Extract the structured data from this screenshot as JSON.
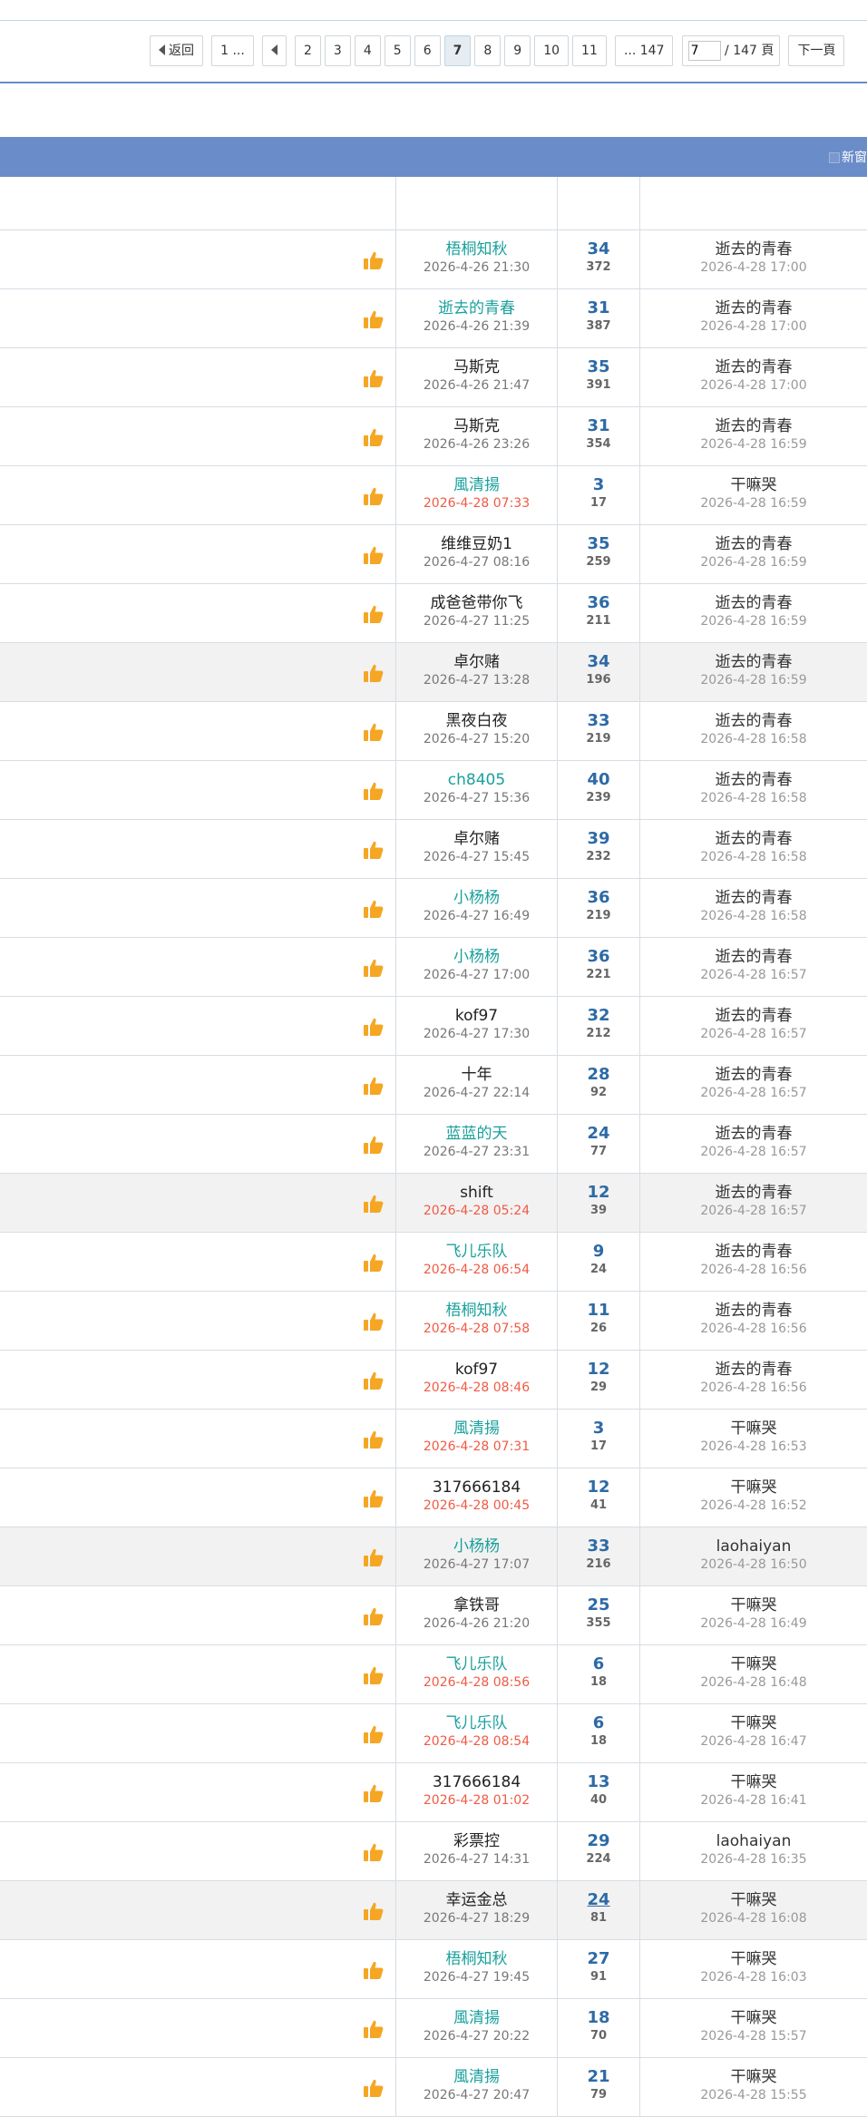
{
  "pager": {
    "back_label": "返回",
    "first_label": "1 ...",
    "pages": [
      "2",
      "3",
      "4",
      "5",
      "6",
      "7",
      "8",
      "9",
      "10",
      "11"
    ],
    "current_page": "7",
    "last_label": "... 147",
    "jump_value": "7",
    "total_label": "/ 147 頁",
    "next_label": "下一頁"
  },
  "header": {
    "newwin_label": "新窗"
  },
  "rows": [
    {
      "author": "梧桐知秋",
      "author_style": "teal",
      "date": "2026-4-26 21:30",
      "date_style": "normal",
      "replies": "34",
      "views": "372",
      "last_user": "逝去的青春",
      "last_date": "2026-4-28 17:00",
      "alt": false,
      "underline": false
    },
    {
      "author": "逝去的青春",
      "author_style": "teal",
      "date": "2026-4-26 21:39",
      "date_style": "normal",
      "replies": "31",
      "views": "387",
      "last_user": "逝去的青春",
      "last_date": "2026-4-28 17:00",
      "alt": false,
      "underline": false
    },
    {
      "author": "马斯克",
      "author_style": "dark",
      "date": "2026-4-26 21:47",
      "date_style": "normal",
      "replies": "35",
      "views": "391",
      "last_user": "逝去的青春",
      "last_date": "2026-4-28 17:00",
      "alt": false,
      "underline": false
    },
    {
      "author": "马斯克",
      "author_style": "dark",
      "date": "2026-4-26 23:26",
      "date_style": "normal",
      "replies": "31",
      "views": "354",
      "last_user": "逝去的青春",
      "last_date": "2026-4-28 16:59",
      "alt": false,
      "underline": false
    },
    {
      "author": "風清揚",
      "author_style": "teal",
      "date": "2026-4-28 07:33",
      "date_style": "new",
      "replies": "3",
      "views": "17",
      "last_user": "干嘛哭",
      "last_date": "2026-4-28 16:59",
      "alt": false,
      "underline": false
    },
    {
      "author": "维维豆奶1",
      "author_style": "dark",
      "date": "2026-4-27 08:16",
      "date_style": "normal",
      "replies": "35",
      "views": "259",
      "last_user": "逝去的青春",
      "last_date": "2026-4-28 16:59",
      "alt": false,
      "underline": false
    },
    {
      "author": "成爸爸带你飞",
      "author_style": "dark",
      "date": "2026-4-27 11:25",
      "date_style": "normal",
      "replies": "36",
      "views": "211",
      "last_user": "逝去的青春",
      "last_date": "2026-4-28 16:59",
      "alt": false,
      "underline": false
    },
    {
      "author": "卓尔赌",
      "author_style": "dark",
      "date": "2026-4-27 13:28",
      "date_style": "normal",
      "replies": "34",
      "views": "196",
      "last_user": "逝去的青春",
      "last_date": "2026-4-28 16:59",
      "alt": true,
      "underline": false
    },
    {
      "author": "黑夜白夜",
      "author_style": "dark",
      "date": "2026-4-27 15:20",
      "date_style": "normal",
      "replies": "33",
      "views": "219",
      "last_user": "逝去的青春",
      "last_date": "2026-4-28 16:58",
      "alt": false,
      "underline": false
    },
    {
      "author": "ch8405",
      "author_style": "teal",
      "date": "2026-4-27 15:36",
      "date_style": "normal",
      "replies": "40",
      "views": "239",
      "last_user": "逝去的青春",
      "last_date": "2026-4-28 16:58",
      "alt": false,
      "underline": false
    },
    {
      "author": "卓尔赌",
      "author_style": "dark",
      "date": "2026-4-27 15:45",
      "date_style": "normal",
      "replies": "39",
      "views": "232",
      "last_user": "逝去的青春",
      "last_date": "2026-4-28 16:58",
      "alt": false,
      "underline": false
    },
    {
      "author": "小杨杨",
      "author_style": "teal",
      "date": "2026-4-27 16:49",
      "date_style": "normal",
      "replies": "36",
      "views": "219",
      "last_user": "逝去的青春",
      "last_date": "2026-4-28 16:58",
      "alt": false,
      "underline": false
    },
    {
      "author": "小杨杨",
      "author_style": "teal",
      "date": "2026-4-27 17:00",
      "date_style": "normal",
      "replies": "36",
      "views": "221",
      "last_user": "逝去的青春",
      "last_date": "2026-4-28 16:57",
      "alt": false,
      "underline": false
    },
    {
      "author": "kof97",
      "author_style": "dark",
      "date": "2026-4-27 17:30",
      "date_style": "normal",
      "replies": "32",
      "views": "212",
      "last_user": "逝去的青春",
      "last_date": "2026-4-28 16:57",
      "alt": false,
      "underline": false
    },
    {
      "author": "十年",
      "author_style": "dark",
      "date": "2026-4-27 22:14",
      "date_style": "normal",
      "replies": "28",
      "views": "92",
      "last_user": "逝去的青春",
      "last_date": "2026-4-28 16:57",
      "alt": false,
      "underline": false
    },
    {
      "author": "蓝蓝的天",
      "author_style": "teal",
      "date": "2026-4-27 23:31",
      "date_style": "normal",
      "replies": "24",
      "views": "77",
      "last_user": "逝去的青春",
      "last_date": "2026-4-28 16:57",
      "alt": false,
      "underline": false
    },
    {
      "author": "shift",
      "author_style": "dark",
      "date": "2026-4-28 05:24",
      "date_style": "new",
      "replies": "12",
      "views": "39",
      "last_user": "逝去的青春",
      "last_date": "2026-4-28 16:57",
      "alt": true,
      "underline": false
    },
    {
      "author": "飞儿乐队",
      "author_style": "teal",
      "date": "2026-4-28 06:54",
      "date_style": "new",
      "replies": "9",
      "views": "24",
      "last_user": "逝去的青春",
      "last_date": "2026-4-28 16:56",
      "alt": false,
      "underline": false
    },
    {
      "author": "梧桐知秋",
      "author_style": "teal",
      "date": "2026-4-28 07:58",
      "date_style": "new",
      "replies": "11",
      "views": "26",
      "last_user": "逝去的青春",
      "last_date": "2026-4-28 16:56",
      "alt": false,
      "underline": false
    },
    {
      "author": "kof97",
      "author_style": "dark",
      "date": "2026-4-28 08:46",
      "date_style": "new",
      "replies": "12",
      "views": "29",
      "last_user": "逝去的青春",
      "last_date": "2026-4-28 16:56",
      "alt": false,
      "underline": false
    },
    {
      "author": "風清揚",
      "author_style": "teal",
      "date": "2026-4-28 07:31",
      "date_style": "new",
      "replies": "3",
      "views": "17",
      "last_user": "干嘛哭",
      "last_date": "2026-4-28 16:53",
      "alt": false,
      "underline": false
    },
    {
      "author": "317666184",
      "author_style": "dark",
      "date": "2026-4-28 00:45",
      "date_style": "new",
      "replies": "12",
      "views": "41",
      "last_user": "干嘛哭",
      "last_date": "2026-4-28 16:52",
      "alt": false,
      "underline": false
    },
    {
      "author": "小杨杨",
      "author_style": "teal",
      "date": "2026-4-27 17:07",
      "date_style": "normal",
      "replies": "33",
      "views": "216",
      "last_user": "laohaiyan",
      "last_date": "2026-4-28 16:50",
      "alt": true,
      "underline": false
    },
    {
      "author": "拿铁哥",
      "author_style": "dark",
      "date": "2026-4-26 21:20",
      "date_style": "normal",
      "replies": "25",
      "views": "355",
      "last_user": "干嘛哭",
      "last_date": "2026-4-28 16:49",
      "alt": false,
      "underline": false
    },
    {
      "author": "飞儿乐队",
      "author_style": "teal",
      "date": "2026-4-28 08:56",
      "date_style": "new",
      "replies": "6",
      "views": "18",
      "last_user": "干嘛哭",
      "last_date": "2026-4-28 16:48",
      "alt": false,
      "underline": false
    },
    {
      "author": "飞儿乐队",
      "author_style": "teal",
      "date": "2026-4-28 08:54",
      "date_style": "new",
      "replies": "6",
      "views": "18",
      "last_user": "干嘛哭",
      "last_date": "2026-4-28 16:47",
      "alt": false,
      "underline": false
    },
    {
      "author": "317666184",
      "author_style": "dark",
      "date": "2026-4-28 01:02",
      "date_style": "new",
      "replies": "13",
      "views": "40",
      "last_user": "干嘛哭",
      "last_date": "2026-4-28 16:41",
      "alt": false,
      "underline": false
    },
    {
      "author": "彩票控",
      "author_style": "dark",
      "date": "2026-4-27 14:31",
      "date_style": "normal",
      "replies": "29",
      "views": "224",
      "last_user": "laohaiyan",
      "last_date": "2026-4-28 16:35",
      "alt": false,
      "underline": false
    },
    {
      "author": "幸运金总",
      "author_style": "dark",
      "date": "2026-4-27 18:29",
      "date_style": "normal",
      "replies": "24",
      "views": "81",
      "last_user": "干嘛哭",
      "last_date": "2026-4-28 16:08",
      "alt": true,
      "underline": true
    },
    {
      "author": "梧桐知秋",
      "author_style": "teal",
      "date": "2026-4-27 19:45",
      "date_style": "normal",
      "replies": "27",
      "views": "91",
      "last_user": "干嘛哭",
      "last_date": "2026-4-28 16:03",
      "alt": false,
      "underline": false
    },
    {
      "author": "風清揚",
      "author_style": "teal",
      "date": "2026-4-27 20:22",
      "date_style": "normal",
      "replies": "18",
      "views": "70",
      "last_user": "干嘛哭",
      "last_date": "2026-4-28 15:57",
      "alt": false,
      "underline": false
    },
    {
      "author": "風清揚",
      "author_style": "teal",
      "date": "2026-4-27 20:47",
      "date_style": "normal",
      "replies": "21",
      "views": "79",
      "last_user": "干嘛哭",
      "last_date": "2026-4-28 15:55",
      "alt": false,
      "underline": false
    }
  ]
}
